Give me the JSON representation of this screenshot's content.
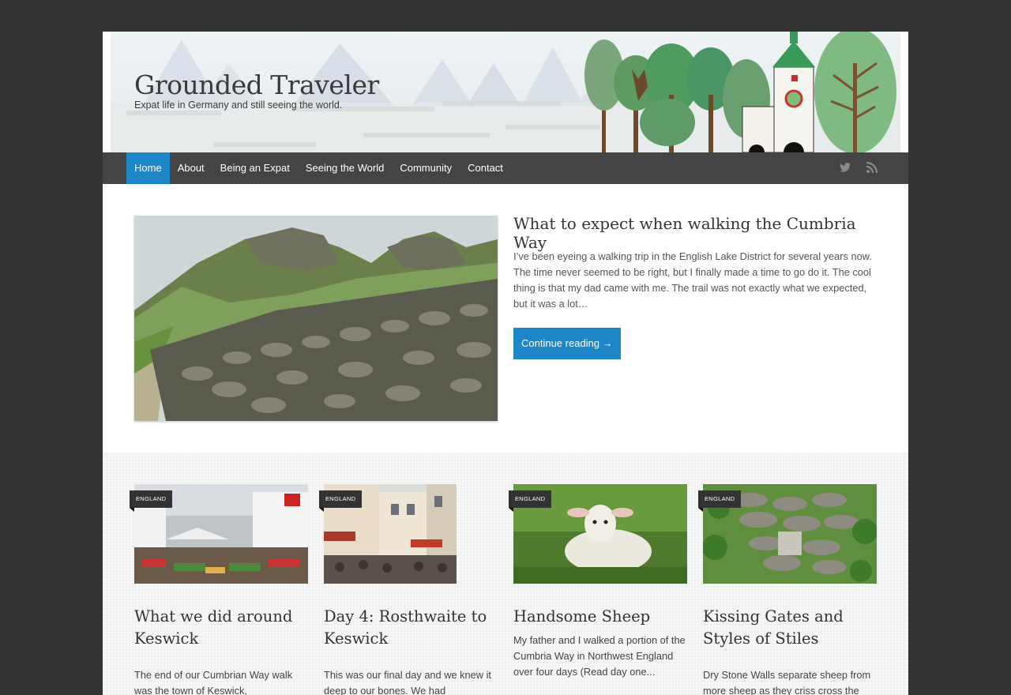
{
  "site": {
    "title": "Grounded Traveler",
    "tagline": "Expat life in Germany and still seeing the world."
  },
  "nav": {
    "items": [
      {
        "label": "Home",
        "active": true
      },
      {
        "label": "About"
      },
      {
        "label": "Being an Expat"
      },
      {
        "label": "Seeing the World"
      },
      {
        "label": "Community"
      },
      {
        "label": "Contact"
      }
    ],
    "social_icons": [
      "twitter-icon",
      "rss-icon"
    ]
  },
  "featured": {
    "title": "What to expect when walking the Cumbria Way",
    "excerpt": "I’ve been eyeing a walking trip in the English Lake District for several years now. The time never seemed to be right, but I finally made a time to go do it. The cool thing is that my dad came with me. The trail was not exactly what we expected, but it was a lot…",
    "button": "Continue reading →"
  },
  "posts": [
    {
      "tag": "England",
      "title": "What we did around Keswick",
      "excerpt": "The end of our Cumbrian Way walk was the town of Keswick,"
    },
    {
      "tag": "England",
      "title": "Day 4: Rosthwaite to Keswick",
      "excerpt": "This was our final day and we knew it deep to our bones. We had"
    },
    {
      "tag": "England",
      "title": "Handsome Sheep",
      "excerpt": "My father and I walked a portion of the Cumbria Way in Northwest England over four days (Read day one... "
    },
    {
      "tag": "England",
      "title": "Kissing Gates and Styles of Stiles",
      "excerpt": "Dry Stone Walls separate sheep from more sheep as they criss cross the"
    }
  ],
  "colors": {
    "accent": "#1e87c8",
    "nav_bg": "#444444",
    "page_bg": "#333333"
  }
}
